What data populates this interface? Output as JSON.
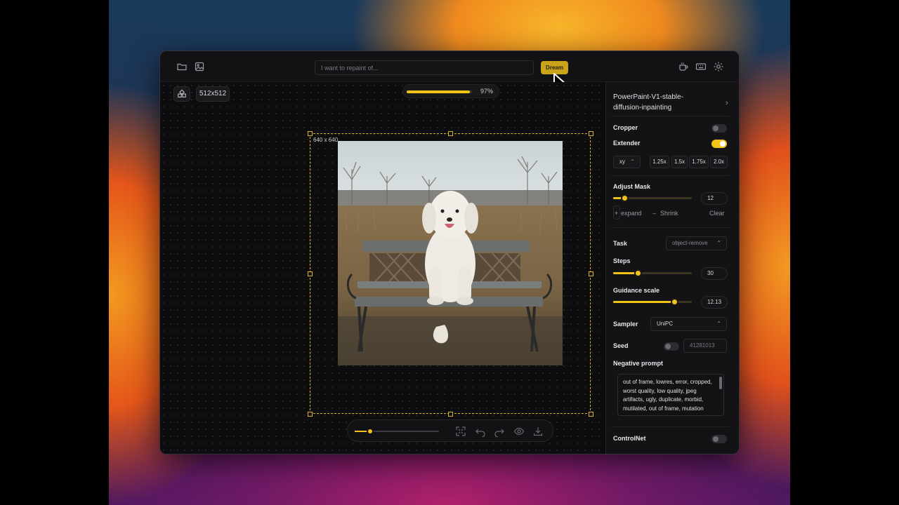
{
  "topbar": {
    "icons": [
      "folder-icon",
      "image-icon",
      "coffee-icon",
      "keyboard-icon",
      "gear-icon"
    ],
    "prompt_placeholder": "I want to repaint of...",
    "dream_label": "Dream"
  },
  "canvas": {
    "size_label": "512x512",
    "progress_text": "97%",
    "progress_fraction": 0.97,
    "extend_label": "640 x 640",
    "zoom_fraction": 0.18
  },
  "sidebar": {
    "model_name": "PowerPaint-V1-stable-diffusion-inpainting",
    "cropper_label": "Cropper",
    "cropper_on": false,
    "extender_label": "Extender",
    "extender_on": true,
    "direction_value": "xy",
    "scales": [
      "1.25x",
      "1.5x",
      "1.75x",
      "2.0x"
    ],
    "adjust_mask_label": "Adjust Mask",
    "adjust_mask_value": "12",
    "adjust_mask_fraction": 0.14,
    "expand_label": "expand",
    "shrink_label": "Shrink",
    "clear_label": "Clear",
    "task_label": "Task",
    "task_value": "object-remove",
    "steps_label": "Steps",
    "steps_value": "30",
    "steps_fraction": 0.31,
    "guidance_label": "Guidance scale",
    "guidance_value": "12.13",
    "guidance_fraction": 0.78,
    "sampler_label": "Sampler",
    "sampler_value": "UniPC",
    "seed_label": "Seed",
    "seed_on": false,
    "seed_value": "41281013",
    "negative_label": "Negative prompt",
    "negative_text": "out of frame, lowres, error, cropped, worst quality, low quality, jpeg artifacts, ugly, duplicate, morbid, mutilated, out of frame, mutation",
    "controlnet_label": "ControlNet",
    "controlnet_on": false
  },
  "colors": {
    "accent": "#f2c418",
    "dream_button": "#c9a41a",
    "window_bg": "#111113",
    "extend_border": "#d9b42a"
  }
}
